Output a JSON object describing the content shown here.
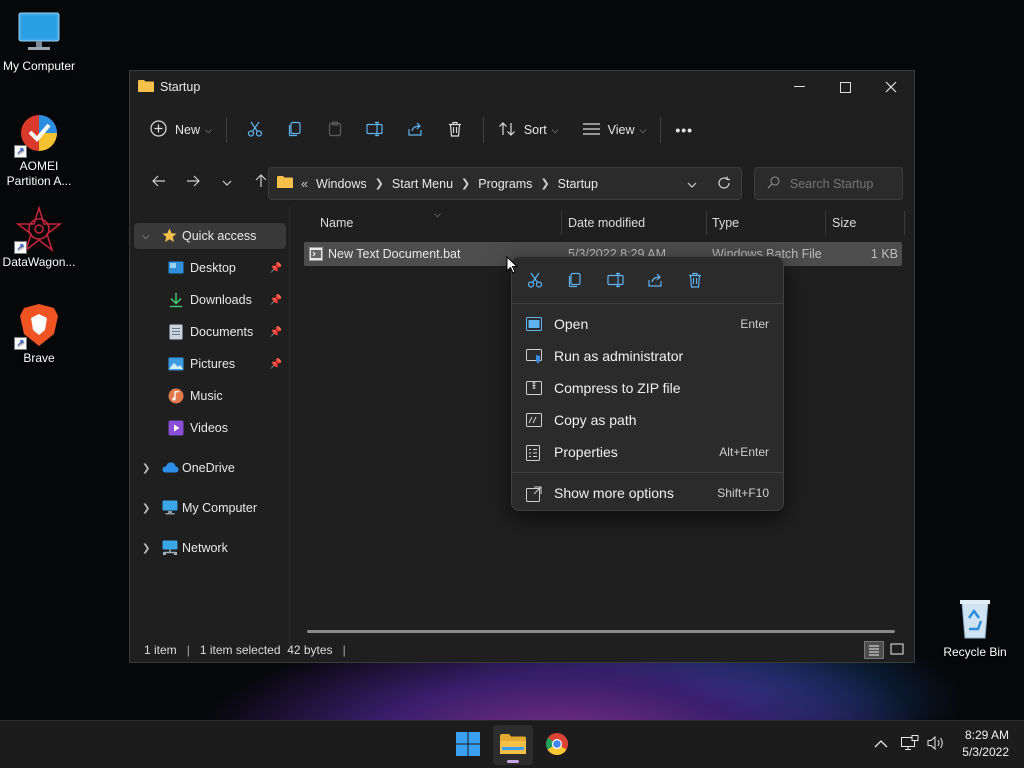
{
  "desktop": {
    "icons": [
      {
        "label": "My Computer",
        "icon": "monitor-icon"
      },
      {
        "label": "AOMEI Partition A...",
        "icon": "aomei-icon"
      },
      {
        "label": "DataWagon...",
        "icon": "datawagon-icon"
      },
      {
        "label": "Brave",
        "icon": "brave-icon"
      },
      {
        "label": "Recycle Bin",
        "icon": "recycle-bin-icon"
      }
    ]
  },
  "window": {
    "title": "Startup",
    "toolbar": {
      "new_label": "New",
      "sort_label": "Sort",
      "view_label": "View",
      "more": "•••"
    },
    "breadcrumb": {
      "overflow": "«",
      "parts": [
        "Windows",
        "Start Menu",
        "Programs",
        "Startup"
      ]
    },
    "search": {
      "placeholder": "Search Startup"
    },
    "sidebar": {
      "items": [
        {
          "label": "Quick access",
          "icon": "star-icon"
        },
        {
          "label": "Desktop",
          "icon": "desktop-icon"
        },
        {
          "label": "Downloads",
          "icon": "download-icon"
        },
        {
          "label": "Documents",
          "icon": "document-icon"
        },
        {
          "label": "Pictures",
          "icon": "picture-icon"
        },
        {
          "label": "Music",
          "icon": "music-icon"
        },
        {
          "label": "Videos",
          "icon": "video-icon"
        },
        {
          "label": "OneDrive",
          "icon": "cloud-icon"
        },
        {
          "label": "My Computer",
          "icon": "monitor-icon"
        },
        {
          "label": "Network",
          "icon": "network-icon"
        }
      ]
    },
    "columns": [
      "Name",
      "Date modified",
      "Type",
      "Size"
    ],
    "files": [
      {
        "name": "New Text Document.bat",
        "date": "5/3/2022 8:29 AM",
        "type": "Windows Batch File",
        "size": "1 KB"
      }
    ],
    "status": {
      "count": "1 item",
      "selected": "1 item selected  42 bytes",
      "divider": "|"
    }
  },
  "context_menu": {
    "items": [
      {
        "label": "Open",
        "shortcut": "Enter",
        "icon": "open-icon"
      },
      {
        "label": "Run as administrator",
        "shortcut": "",
        "icon": "shield-icon"
      },
      {
        "label": "Compress to ZIP file",
        "shortcut": "",
        "icon": "zip-icon"
      },
      {
        "label": "Copy as path",
        "shortcut": "",
        "icon": "path-icon"
      },
      {
        "label": "Properties",
        "shortcut": "Alt+Enter",
        "icon": "properties-icon"
      },
      {
        "label": "Show more options",
        "shortcut": "Shift+F10",
        "icon": "more-options-icon"
      }
    ]
  },
  "taskbar": {
    "clock": {
      "time": "8:29 AM",
      "date": "5/3/2022"
    },
    "tray_up": "^"
  },
  "colors": {
    "window_bg": "#1f1f1f",
    "accent": "#4aa3f0",
    "folder": "#f4c04a"
  }
}
